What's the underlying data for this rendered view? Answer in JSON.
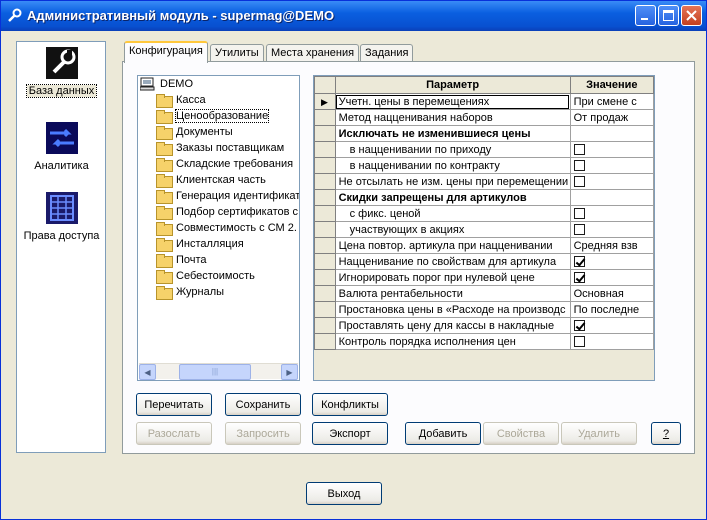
{
  "window": {
    "title": "Административный модуль - supermag@DEMO",
    "controls": {
      "minimize": "minimize-icon",
      "maximize": "maximize-icon",
      "close": "close-icon"
    }
  },
  "nav": {
    "items": [
      {
        "label": "База данных",
        "icon": "database-tools-icon",
        "active": true
      },
      {
        "label": "Аналитика",
        "icon": "analytics-icon",
        "active": false
      },
      {
        "label": "Права доступа",
        "icon": "access-rights-icon",
        "active": false
      }
    ]
  },
  "tabs": [
    {
      "label": "Конфигурация",
      "active": true
    },
    {
      "label": "Утилиты",
      "active": false
    },
    {
      "label": "Места хранения",
      "active": false
    },
    {
      "label": "Задания",
      "active": false
    }
  ],
  "tree": {
    "root": "DEMO",
    "items": [
      {
        "label": "Касса",
        "selected": false
      },
      {
        "label": "Ценообразование",
        "selected": true
      },
      {
        "label": "Документы",
        "selected": false
      },
      {
        "label": "Заказы поставщикам",
        "selected": false
      },
      {
        "label": "Складские требования",
        "selected": false
      },
      {
        "label": "Клиентская часть",
        "selected": false
      },
      {
        "label": "Генерация идентификат",
        "selected": false
      },
      {
        "label": "Подбор сертификатов с",
        "selected": false
      },
      {
        "label": "Совместимость с СМ 2.",
        "selected": false
      },
      {
        "label": "Инсталляция",
        "selected": false
      },
      {
        "label": "Почта",
        "selected": false
      },
      {
        "label": "Себестоимость",
        "selected": false
      },
      {
        "label": "Журналы",
        "selected": false
      }
    ]
  },
  "grid": {
    "headers": {
      "param": "Параметр",
      "value": "Значение"
    },
    "rows": [
      {
        "param": "Учетн. цены в перемещениях",
        "value": "При смене с",
        "type": "text",
        "current": true
      },
      {
        "param": "Метод нацценивания наборов",
        "value": "От продаж",
        "type": "text"
      },
      {
        "param": "Исключать не изменившиеся цены",
        "type": "group"
      },
      {
        "param": "в нацценивании по приходу",
        "type": "check",
        "checked": false,
        "indent": true
      },
      {
        "param": "в нацценивании по контракту",
        "type": "check",
        "checked": false,
        "indent": true
      },
      {
        "param": "Не отсылать не изм. цены при перемещении",
        "type": "check",
        "checked": false
      },
      {
        "param": "Скидки запрещены для артикулов",
        "type": "group"
      },
      {
        "param": "с фикс. ценой",
        "type": "check",
        "checked": false,
        "indent": true
      },
      {
        "param": "участвующих в акциях",
        "type": "check",
        "checked": false,
        "indent": true
      },
      {
        "param": "Цена повтор. артикула при нацценивании",
        "value": "Средняя взв",
        "type": "text"
      },
      {
        "param": "Нацценивание по свойствам для артикула",
        "type": "check",
        "checked": true
      },
      {
        "param": "Игнорировать порог при нулевой цене",
        "type": "check",
        "checked": true
      },
      {
        "param": "Валюта рентабельности",
        "value": "Основная",
        "type": "text"
      },
      {
        "param": "Простановка цены в «Расходе на производс",
        "value": "По последне",
        "type": "text"
      },
      {
        "param": "Проставлять цену для кассы в накладные",
        "type": "check",
        "checked": true
      },
      {
        "param": "Контроль порядка исполнения цен",
        "type": "check",
        "checked": false
      }
    ]
  },
  "buttons": {
    "reread": "Перечитать",
    "save": "Сохранить",
    "conflicts": "Конфликты",
    "send": "Разослать",
    "request": "Запросить",
    "export": "Экспорт",
    "add": "Добавить",
    "properties": "Свойства",
    "delete": "Удалить",
    "help": "?",
    "exit": "Выход"
  }
}
